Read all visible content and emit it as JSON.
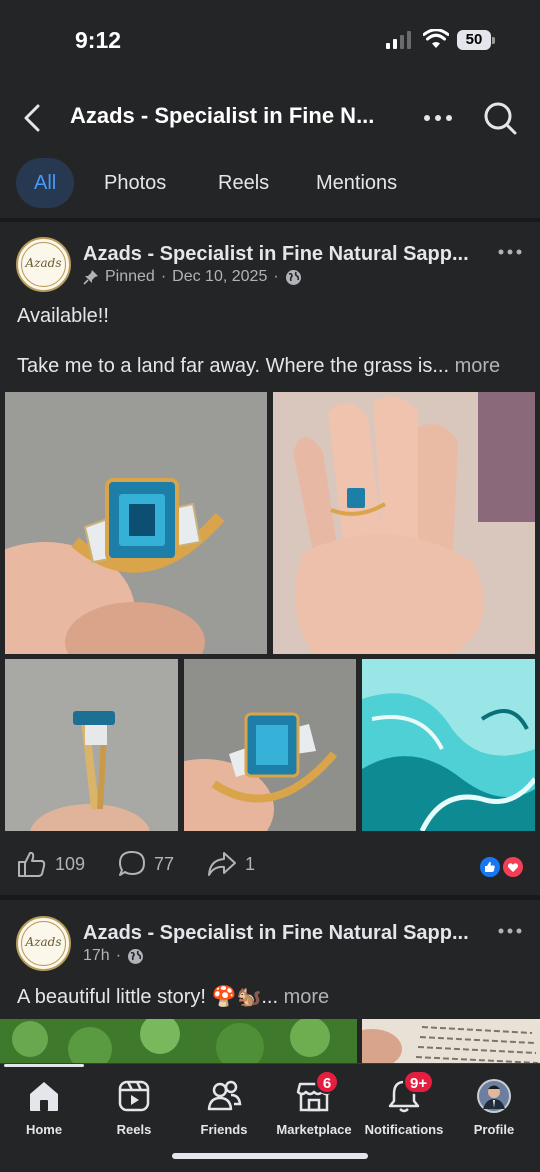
{
  "status_bar": {
    "time": "9:12",
    "battery": "50"
  },
  "header": {
    "title": "Azads - Specialist in Fine N..."
  },
  "tabs": [
    {
      "label": "All",
      "active": true
    },
    {
      "label": "Photos",
      "active": false
    },
    {
      "label": "Reels",
      "active": false
    },
    {
      "label": "Mentions",
      "active": false
    }
  ],
  "posts": [
    {
      "author": "Azads - Specialist in Fine Natural Sapp...",
      "avatar_text": "Azads",
      "meta": {
        "pinned": "Pinned",
        "separator": "·",
        "date": "Dec 10, 2025"
      },
      "text_line1": "Available!!",
      "text_line2": "Take me to a land far away. Where the grass is...",
      "more": "more",
      "likes": "109",
      "comments": "77",
      "shares": "1"
    },
    {
      "author": "Azads - Specialist in Fine Natural Sapp...",
      "avatar_text": "Azads",
      "meta": {
        "date": "17h",
        "separator": "·"
      },
      "text": "A beautiful little story! 🍄🐿️...",
      "more": "more"
    }
  ],
  "bottom_nav": [
    {
      "label": "Home",
      "icon": "home-icon",
      "active": true
    },
    {
      "label": "Reels",
      "icon": "reels-icon"
    },
    {
      "label": "Friends",
      "icon": "friends-icon"
    },
    {
      "label": "Marketplace",
      "icon": "marketplace-icon",
      "badge": "6"
    },
    {
      "label": "Notifications",
      "icon": "bell-icon",
      "badge": "9+"
    },
    {
      "label": "Profile",
      "icon": "profile-avatar"
    }
  ],
  "colors": {
    "background": "#242526",
    "accent": "#4599ff",
    "badge": "#e41e3f",
    "like": "#1877f2",
    "love": "#f33e58"
  }
}
